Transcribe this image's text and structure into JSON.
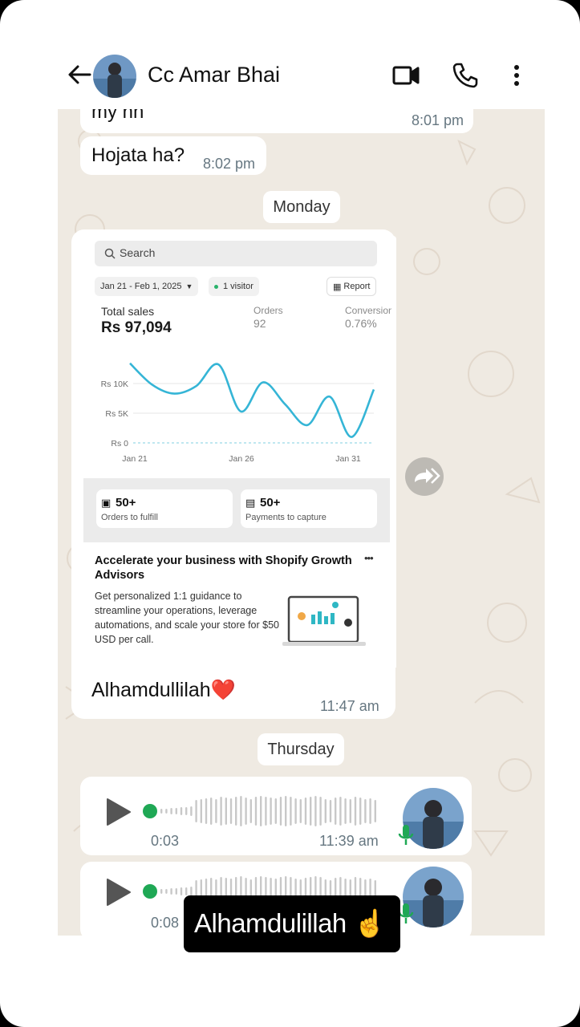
{
  "header": {
    "contact_name": "Cc Amar Bhai"
  },
  "messages": [
    {
      "text": "my nh",
      "time": "8:01 pm"
    },
    {
      "text": "Hojata ha?",
      "time": "8:02 pm"
    }
  ],
  "day_labels": {
    "monday": "Monday",
    "thursday": "Thursday"
  },
  "shared_screenshot": {
    "search_placeholder": "Search",
    "date_range": "Jan 21 - Feb 1, 2025",
    "visitors": "1 visitor",
    "report_label": "Report",
    "total_sales_label": "Total sales",
    "total_sales_value": "Rs 97,094",
    "orders_label": "Orders",
    "orders_value": "92",
    "conversion_label": "Conversion",
    "conversion_value": "0.76%",
    "card1_value": "50+",
    "card1_label": "Orders to fulfill",
    "card2_value": "50+",
    "card2_label": "Payments to capture",
    "advisor_title": "Accelerate your business with Shopify Growth Advisors",
    "advisor_body": "Get personalized 1:1 guidance to streamline your operations, leverage automations, and scale your store for $50 USD per call.",
    "more_label": "•••"
  },
  "chart_data": {
    "type": "line",
    "x_tick_labels": [
      "Jan 21",
      "Jan 26",
      "Jan 31"
    ],
    "y_tick_labels": [
      "Rs 10K",
      "Rs 5K",
      "Rs 0"
    ],
    "ylim": [
      0,
      10000
    ],
    "x": [
      1,
      2,
      3,
      4,
      5,
      6,
      7,
      8,
      9,
      10,
      11,
      12
    ],
    "values": [
      13400,
      9800,
      8300,
      9600,
      13200,
      5300,
      10200,
      6500,
      3000,
      7800,
      1000,
      9000
    ],
    "color": "#35b5d6"
  },
  "photo_caption": {
    "text": "Alhamdullilah❤️",
    "time": "11:47 am"
  },
  "voice_notes": [
    {
      "duration": "0:03",
      "time": "11:39 am"
    },
    {
      "duration": "0:08",
      "time": ""
    }
  ],
  "story_caption": "Alhamdulillah ☝️",
  "colors": {
    "chat_bg": "#efeae2",
    "voice_dot": "#1fa855",
    "mic": "#1fa855"
  }
}
